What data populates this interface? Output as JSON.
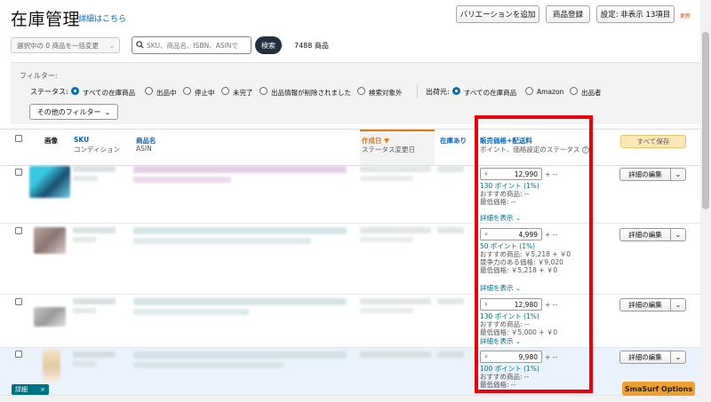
{
  "header": {
    "title": "在庫管理",
    "detail_link": "詳細はこちら",
    "btn_add_variation": "バリエーションを追加",
    "btn_register": "商品登録",
    "btn_settings": "設定: 非表示 13項目",
    "update_link": "更新"
  },
  "toolbar": {
    "bulk_action": "選択中の 0 商品を一括変更",
    "search_placeholder": "SKU、商品名、ISBN、ASINで",
    "search_button": "検索",
    "count": "7488 商品"
  },
  "filter": {
    "label": "フィルター:",
    "status_label": "ステータス:",
    "status_options": [
      "すべての在庫商品",
      "出品中",
      "停止中",
      "未完了",
      "出品情報が削除されました",
      "検索対象外"
    ],
    "channel_label": "出荷元:",
    "channel_options": [
      "すべての在庫商品",
      "Amazon",
      "出品者"
    ],
    "more_filters": "その他のフィルター"
  },
  "table": {
    "col_image": "画像",
    "col_sku": "SKU",
    "col_condition": "コンディション",
    "col_name": "商品名",
    "col_asin": "ASIN",
    "col_created": "作成日",
    "col_status_changed": "ステータス変更日",
    "col_stock": "在庫あり",
    "col_price": "販売価格+配送料",
    "col_price_sub": "ポイント、価格設定のステータス",
    "save_all": "すべて保存"
  },
  "rows": [
    {
      "yen": "¥",
      "price": "12,990",
      "plus": "+ --",
      "points": "130 ポイント (1%)",
      "recommended": "おすすめ商品: --",
      "competitive": "",
      "lowest": "最低価格: --",
      "show_detail": "詳細を表示",
      "edit": "詳細の編集"
    },
    {
      "yen": "¥",
      "price": "4,999",
      "plus": "+ --",
      "points": "50 ポイント (1%)",
      "recommended": "おすすめ商品: ￥5,218 + ￥0",
      "competitive": "競争力のある価格: ￥9,020",
      "lowest": "最低価格: ￥5,218 + ￥0",
      "show_detail": "詳細を表示",
      "edit": "詳細の編集"
    },
    {
      "yen": "¥",
      "price": "12,980",
      "plus": "+ --",
      "points": "130 ポイント (1%)",
      "recommended": "おすすめ商品: --",
      "competitive": "",
      "lowest": "最低価格: ￥5,000 + ￥0",
      "show_detail": "詳細を表示",
      "edit": "詳細の編集"
    },
    {
      "yen": "¥",
      "price": "9,980",
      "plus": "+ --",
      "points": "100 ポイント (1%)",
      "recommended": "おすすめ商品: --",
      "competitive": "",
      "lowest": "最低価格: --",
      "show_detail": "",
      "edit": "詳細の編集"
    }
  ],
  "footer": {
    "tag_label": "詳細",
    "tag_close": "×",
    "smasurf": "SmaSurf Options"
  },
  "colors": {
    "accent": "#0066c0",
    "highlight": "#e8000b",
    "teal": "#007185",
    "orange": "#e47911"
  },
  "icons": [
    "search-icon",
    "chevron-down-icon",
    "info-icon",
    "close-icon"
  ]
}
